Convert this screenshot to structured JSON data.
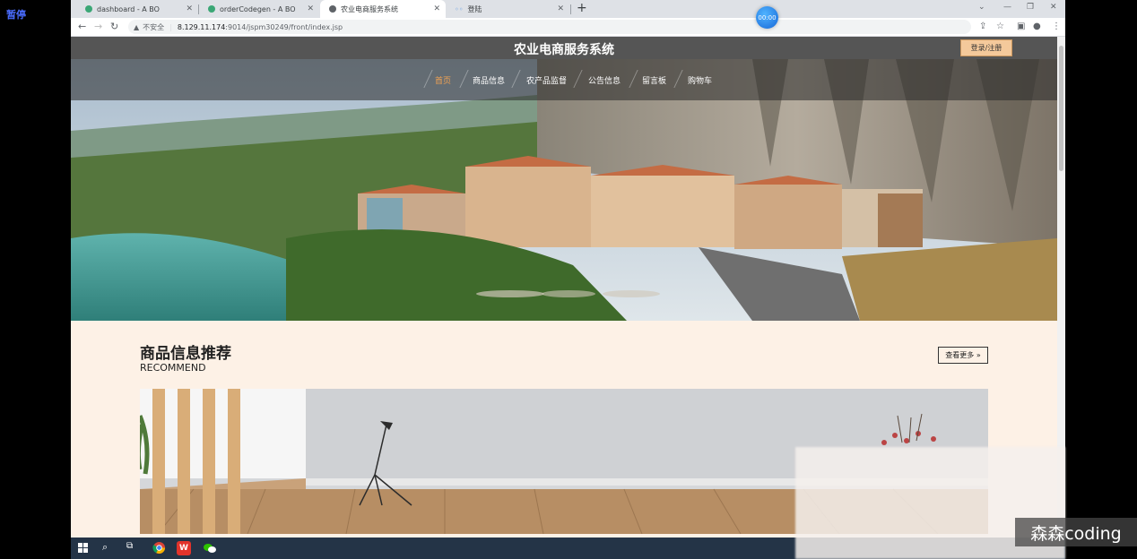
{
  "recorder": {
    "pause_label": "暂停",
    "timer": "00:00"
  },
  "browser": {
    "tabs": [
      {
        "title": "dashboard - A BO",
        "active": false
      },
      {
        "title": "orderCodegen - A BO",
        "active": false
      },
      {
        "title": "农业电商服务系统",
        "active": true
      },
      {
        "title": "登陆",
        "active": false
      }
    ],
    "address": {
      "security_label": "不安全",
      "host": "8.129.11.174",
      "path": ":9014/jspm30249/front/index.jsp"
    }
  },
  "site": {
    "title": "农业电商服务系统",
    "login_label": "登录/注册",
    "nav": [
      "首页",
      "商品信息",
      "农产品监督",
      "公告信息",
      "留言板",
      "购物车"
    ],
    "active_nav": "首页"
  },
  "recommend": {
    "title": "商品信息推荐",
    "subtitle": "RECOMMEND",
    "more_label": "查看更多 »"
  },
  "watermark": "森森coding",
  "colors": {
    "accent": "#f4a352",
    "header": "#555555",
    "page_bg": "#fdf1e6",
    "login_bg": "#f4c99b"
  },
  "icons": [
    "back-icon",
    "forward-icon",
    "reload-icon",
    "warning-icon",
    "share-icon",
    "star-icon",
    "sidebar-icon",
    "profile-icon",
    "menu-icon",
    "windows-start-icon",
    "search-icon",
    "taskview-icon",
    "chrome-icon",
    "wps-icon",
    "wechat-icon"
  ]
}
